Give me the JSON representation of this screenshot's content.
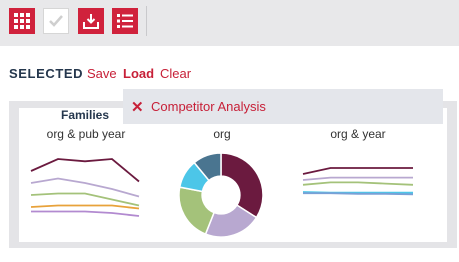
{
  "colors": {
    "accent": "#c72038",
    "toolbar_bg": "#e8e8ea",
    "navy": "#25374d"
  },
  "toolbar": {
    "buttons": [
      {
        "icon": "grid-icon",
        "active": true
      },
      {
        "icon": "checkmark-icon",
        "active": false
      },
      {
        "icon": "download-tray-icon",
        "active": true
      },
      {
        "icon": "list-icon",
        "active": true
      }
    ]
  },
  "selection": {
    "label": "SELECTED",
    "save": "Save",
    "load": "Load",
    "clear": "Clear"
  },
  "load_dropdown": {
    "items": [
      {
        "label": "Competitor Analysis",
        "icon": "remove-x-icon"
      }
    ]
  },
  "panel": {
    "heading": "Families",
    "charts": [
      {
        "title": "org & pub year",
        "type": "line",
        "series": [
          {
            "color": "#6b1a3f",
            "values": [
              72,
              88,
              85,
              88,
              58
            ]
          },
          {
            "color": "#b8a8d0",
            "values": [
              56,
              62,
              56,
              48,
              38
            ]
          },
          {
            "color": "#a4c27a",
            "values": [
              40,
              42,
              42,
              34,
              26
            ]
          },
          {
            "color": "#e8a23a",
            "values": [
              24,
              26,
              26,
              26,
              22
            ]
          },
          {
            "color": "#b28ad0",
            "values": [
              18,
              18,
              18,
              16,
              12
            ]
          }
        ]
      },
      {
        "title": "org",
        "type": "pie",
        "slices": [
          {
            "color": "#6b1a3f",
            "value": 34
          },
          {
            "color": "#b8a8d0",
            "value": 22
          },
          {
            "color": "#a4c27a",
            "value": 22
          },
          {
            "color": "#4cc6e8",
            "value": 11
          },
          {
            "color": "#4a7590",
            "value": 11
          }
        ]
      },
      {
        "title": "org & year",
        "type": "line",
        "series": [
          {
            "color": "#6b1a3f",
            "values": [
              60,
              70,
              70,
              70,
              70
            ]
          },
          {
            "color": "#b8a8d0",
            "values": [
              50,
              54,
              54,
              54,
              54
            ]
          },
          {
            "color": "#a4c27a",
            "values": [
              42,
              46,
              46,
              44,
              42
            ]
          },
          {
            "color": "#4cc6e8",
            "values": [
              30,
              29,
              29,
              29,
              29
            ]
          },
          {
            "color": "#7aa0d6",
            "values": [
              28,
              28,
              27,
              27,
              26
            ]
          }
        ]
      }
    ]
  }
}
